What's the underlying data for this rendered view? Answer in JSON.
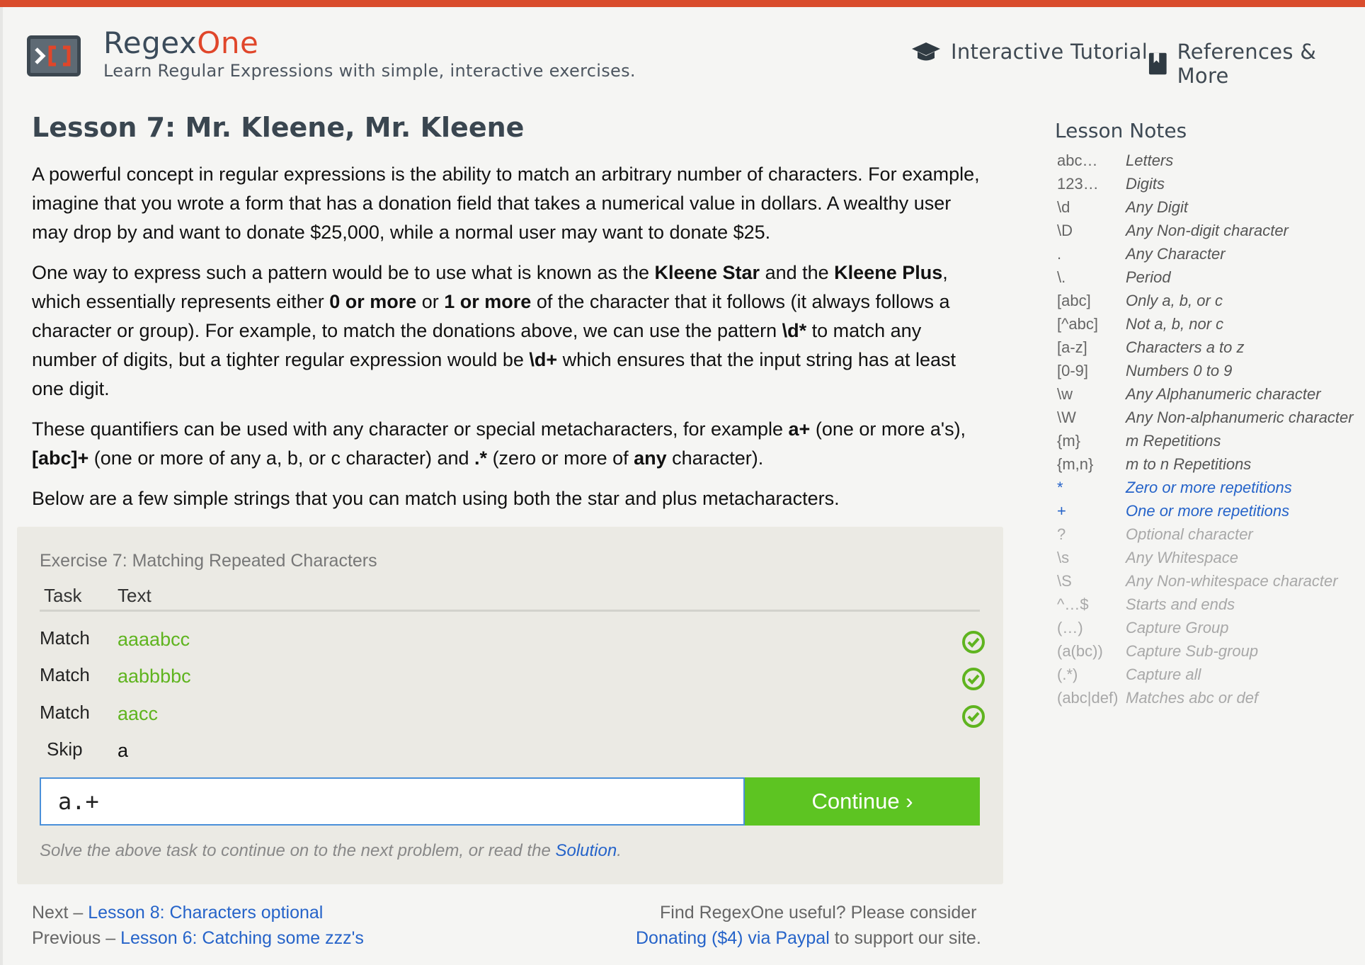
{
  "header": {
    "brand_main": "Regex",
    "brand_accent": "One",
    "tagline": "Learn Regular Expressions with simple, interactive exercises.",
    "nav": [
      {
        "label": "Interactive Tutorial",
        "icon": "graduation-cap-icon"
      },
      {
        "label": "References & More",
        "icon": "bookmark-icon"
      }
    ]
  },
  "lesson": {
    "title": "Lesson 7: Mr. Kleene, Mr. Kleene",
    "p1": "A powerful concept in regular expressions is the ability to match an arbitrary number of characters. For example, imagine that you wrote a form that has a donation field that takes a numerical value in dollars. A wealthy user may drop by and want to donate $25,000, while a normal user may want to donate $25.",
    "p2": {
      "t1": "One way to express such a pattern would be to use what is known as the ",
      "b1": "Kleene Star",
      "t2": " and the ",
      "b2": "Kleene Plus",
      "t3": ", which essentially represents either ",
      "b3": "0 or more",
      "t4": " or ",
      "b4": "1 or more",
      "t5": " of the character that it follows (it always follows a character or group). For example, to match the donations above, we can use the pattern ",
      "b5": "\\d*",
      "t6": " to match any number of digits, but a tighter regular expression would be ",
      "b6": "\\d+",
      "t7": " which ensures that the input string has at least one digit."
    },
    "p3": {
      "t1": "These quantifiers can be used with any character or special metacharacters, for example ",
      "b1": "a+",
      "t2": " (one or more a's), ",
      "b2": "[abc]+",
      "t3": " (one or more of any a, b, or c character) and ",
      "b3": ".*",
      "t4": " (zero or more of ",
      "b4": "any",
      "t5": " character)."
    },
    "p4": "Below are a few simple strings that you can match using both the star and plus metacharacters."
  },
  "exercise": {
    "title": "Exercise 7: Matching Repeated Characters",
    "col_task": "Task",
    "col_text": "Text",
    "rows": [
      {
        "task": "Match",
        "text": "aaaabcc",
        "status": "check-circle-icon"
      },
      {
        "task": "Match",
        "text": "aabbbbc",
        "status": "check-circle-icon"
      },
      {
        "task": "Match",
        "text": "aacc",
        "status": "check-circle-icon"
      },
      {
        "task": "Skip",
        "text": "a"
      }
    ],
    "input_value": "a.+",
    "continue_label": "Continue ›",
    "hint_text": "Solve the above task to continue on to the next problem, or read the ",
    "hint_link": "Solution",
    "hint_end": "."
  },
  "footer": {
    "next_prefix": "Next – ",
    "next_link": "Lesson 8: Characters optional",
    "prev_prefix": "Previous – ",
    "prev_link": "Lesson 6: Catching some zzz's",
    "donate_text": "Find RegexOne useful? Please consider",
    "donate_link": "Donating ($4) via Paypal",
    "donate_suffix": " to support our site."
  },
  "notes": {
    "title": "Lesson Notes",
    "items": [
      {
        "k": "abc…",
        "v": "Letters"
      },
      {
        "k": "123…",
        "v": "Digits"
      },
      {
        "k": "\\d",
        "v": "Any Digit"
      },
      {
        "k": "\\D",
        "v": "Any Non-digit character"
      },
      {
        "k": ".",
        "v": "Any Character"
      },
      {
        "k": "\\.",
        "v": "Period"
      },
      {
        "k": "[abc]",
        "v": "Only a, b, or c"
      },
      {
        "k": "[^abc]",
        "v": "Not a, b, nor c"
      },
      {
        "k": "[a-z]",
        "v": "Characters a to z"
      },
      {
        "k": "[0-9]",
        "v": "Numbers 0 to 9"
      },
      {
        "k": "\\w",
        "v": "Any Alphanumeric character"
      },
      {
        "k": "\\W",
        "v": "Any Non-alphanumeric character"
      },
      {
        "k": "{m}",
        "v": "m Repetitions"
      },
      {
        "k": "{m,n}",
        "v": "m to n Repetitions"
      },
      {
        "k": "*",
        "v": "Zero or more repetitions"
      },
      {
        "k": "+",
        "v": "One or more repetitions"
      },
      {
        "k": "?",
        "v": "Optional character"
      },
      {
        "k": "\\s",
        "v": "Any Whitespace"
      },
      {
        "k": "\\S",
        "v": "Any Non-whitespace character"
      },
      {
        "k": "^…$",
        "v": "Starts and ends"
      },
      {
        "k": "(…)",
        "v": "Capture Group"
      },
      {
        "k": "(a(bc))",
        "v": "Capture Sub-group"
      },
      {
        "k": "(.*)",
        "v": "Capture all"
      },
      {
        "k": "(abc|def)",
        "v": "Matches abc or def"
      }
    ]
  },
  "colors": {
    "accent": "#d94c2c",
    "match_green": "#5fb41f",
    "button_green": "#5dc422",
    "link_blue": "#2563c9"
  }
}
